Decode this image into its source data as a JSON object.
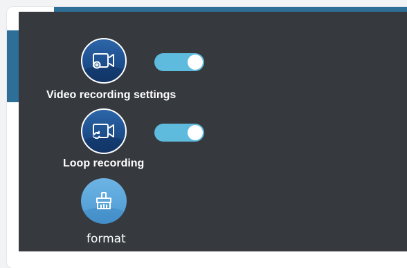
{
  "settings": {
    "video_recording": {
      "label": "Video recording settings",
      "icon": "camera-settings-icon",
      "enabled": true
    },
    "loop_recording": {
      "label": "Loop recording",
      "icon": "loop-camera-icon",
      "enabled": true
    },
    "format": {
      "label": "format",
      "icon": "broom-icon"
    }
  },
  "colors": {
    "panel_background": "#363a3e",
    "toggle_on": "#5ebbdd",
    "accent_blue": "#2d6f97",
    "icon_blue": "#1d4f8e",
    "icon_light_blue": "#5aa6db"
  }
}
